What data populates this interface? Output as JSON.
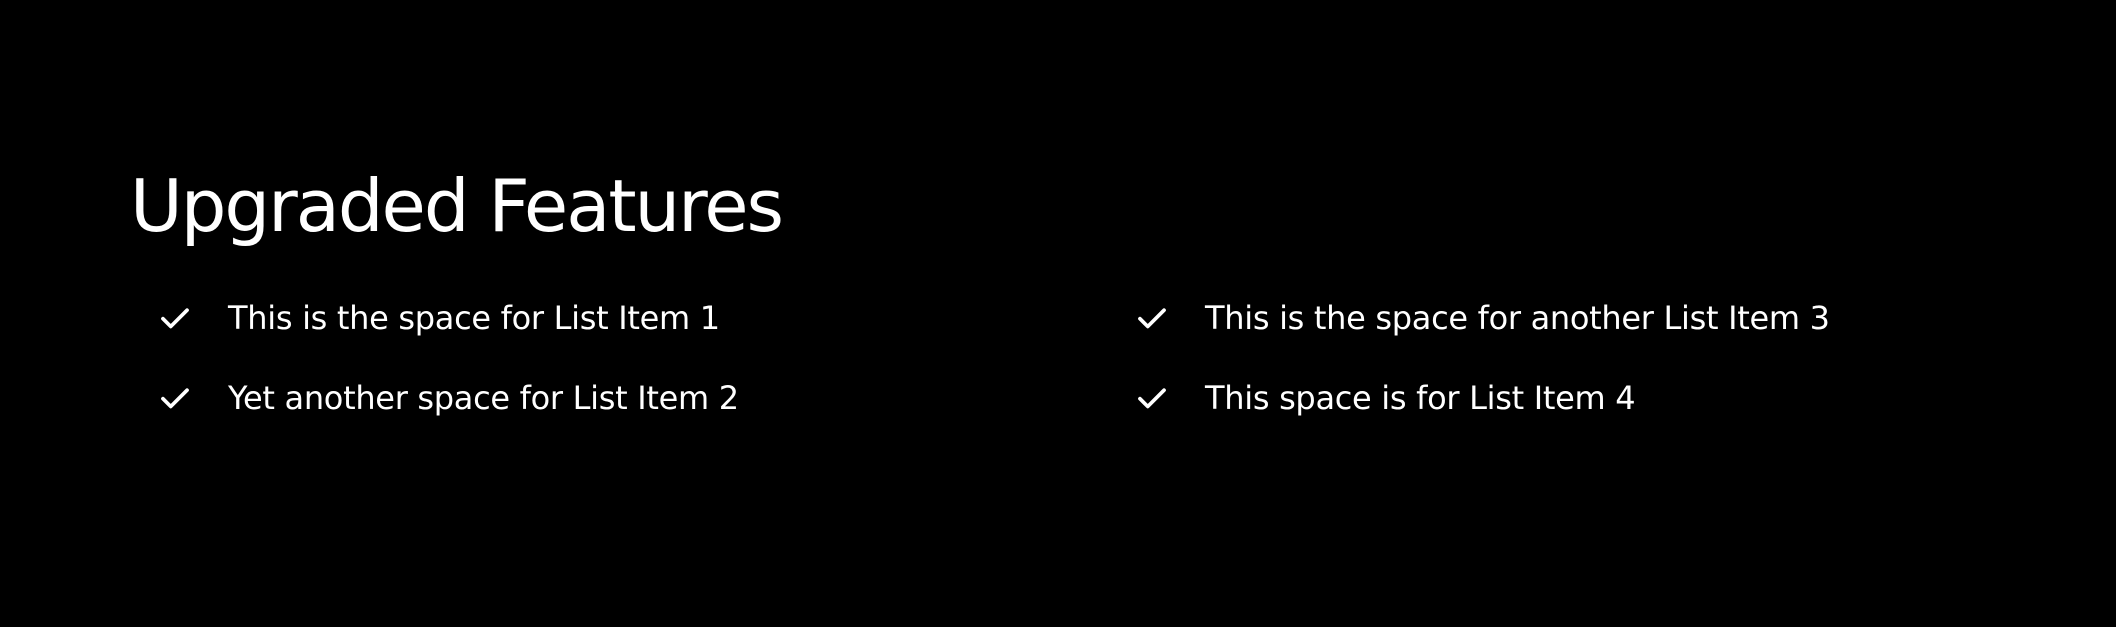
{
  "section": {
    "title": "Upgraded Features",
    "items": [
      {
        "label": "This is the space for List Item 1",
        "icon": "checkmark-icon"
      },
      {
        "label": "This is the space for another List Item 3",
        "icon": "checkmark-icon"
      },
      {
        "label": "Yet another space for List Item 2",
        "icon": "checkmark-icon"
      },
      {
        "label": "This space is for List Item 4",
        "icon": "checkmark-icon"
      }
    ]
  },
  "colors": {
    "background": "#000000",
    "text": "#ffffff"
  }
}
